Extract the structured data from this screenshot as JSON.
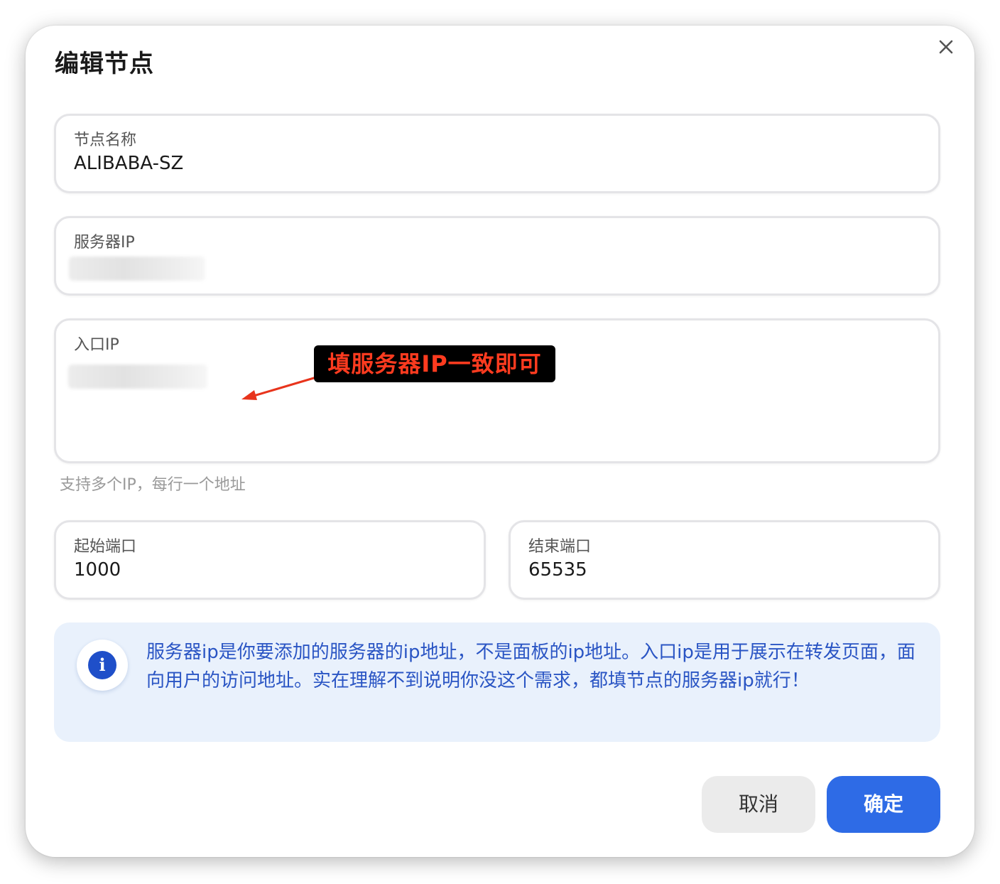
{
  "dialog": {
    "title": "编辑节点",
    "close_icon": "close-icon"
  },
  "form": {
    "node_name": {
      "label": "节点名称",
      "value": "ALIBABA-SZ"
    },
    "server_ip": {
      "label": "服务器IP",
      "value_state": "blurred"
    },
    "entry_ip": {
      "label": "入口IP",
      "value_state": "blurred",
      "helper": "支持多个IP，每行一个地址"
    },
    "start_port": {
      "label": "起始端口",
      "value": "1000"
    },
    "end_port": {
      "label": "结束端口",
      "value": "65535"
    }
  },
  "annotation": {
    "text": "填服务器IP一致即可",
    "text_color": "#ff3b1f",
    "background": "#000000"
  },
  "info": {
    "icon": "info-icon",
    "text": "服务器ip是你要添加的服务器的ip地址，不是面板的ip地址。入口ip是用于展示在转发页面，面向用户的访问地址。实在理解不到说明你没这个需求，都填节点的服务器ip就行！"
  },
  "actions": {
    "cancel_label": "取消",
    "confirm_label": "确定"
  },
  "colors": {
    "primary": "#2e6be6",
    "info_bg": "#e9f1fc",
    "info_text": "#2a55c4"
  }
}
